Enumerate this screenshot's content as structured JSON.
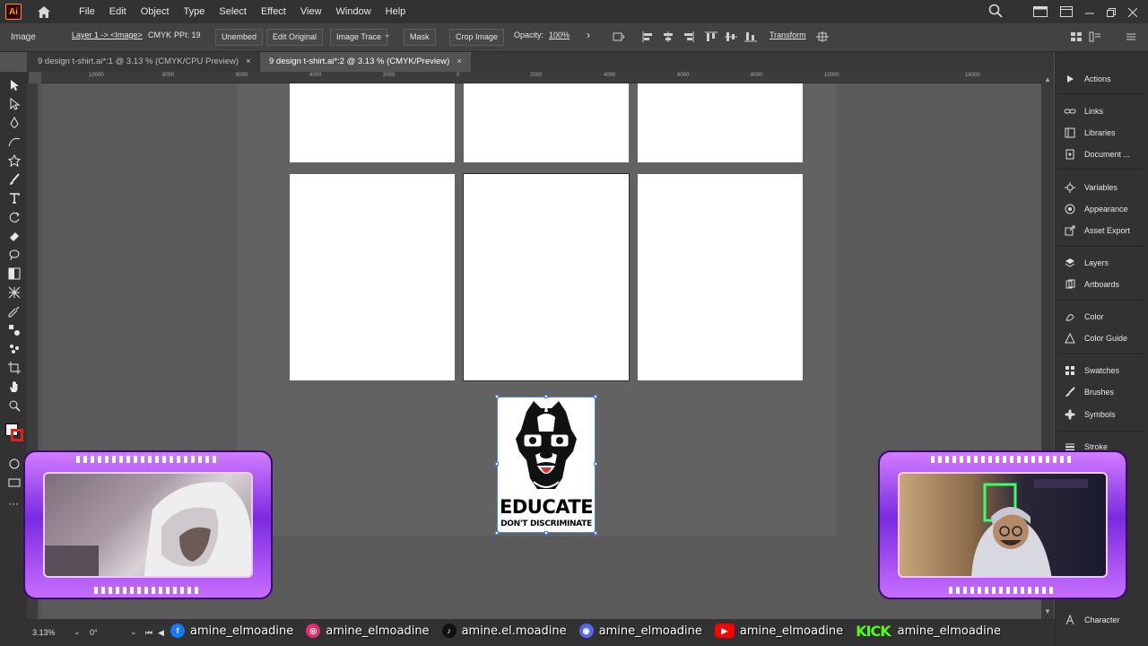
{
  "app": {
    "logo": "Ai"
  },
  "menu": [
    "File",
    "Edit",
    "Object",
    "Type",
    "Select",
    "Effect",
    "View",
    "Window",
    "Help"
  ],
  "control": {
    "image": "Image",
    "layer": "Layer 1 -> <Image>",
    "mode": "CMYK",
    "ppi": "PPI: 19",
    "unembed": "Unembed",
    "edit_original": "Edit Original",
    "image_trace": "Image Trace",
    "mask": "Mask",
    "crop": "Crop Image",
    "opacity_label": "Opacity:",
    "opacity_value": "100%",
    "transform": "Transform"
  },
  "tabs": [
    {
      "label": "9 design t-shirt.ai*:1 @ 3.13 % (CMYK/CPU Preview)",
      "close": "×"
    },
    {
      "label": "9 design t-shirt.ai*:2 @ 3.13 % (CMYK/Preview)",
      "close": "×"
    }
  ],
  "ruler": [
    "10000",
    "8000",
    "6000",
    "4000",
    "2000",
    "0",
    "2000",
    "4000",
    "6000",
    "8000",
    "10000",
    "14000"
  ],
  "artwork": {
    "title": "EDUCATE",
    "subtitle": "DON'T DISCRIMINATE"
  },
  "panels": [
    "Actions",
    "Links",
    "Libraries",
    "Document ...",
    "Variables",
    "Appearance",
    "Asset Export",
    "Layers",
    "Artboards",
    "Color",
    "Color Guide",
    "Swatches",
    "Brushes",
    "Symbols",
    "Stroke",
    "Character"
  ],
  "status": {
    "zoom": "3.13%",
    "rotation": "0°"
  },
  "social": [
    {
      "icon": "facebook-icon",
      "letter": "f",
      "color": "#1877f2",
      "handle": "amine_elmoadine"
    },
    {
      "icon": "instagram-icon",
      "letter": "◎",
      "color": "#e1306c",
      "handle": "amine_elmoadine"
    },
    {
      "icon": "tiktok-icon",
      "letter": "♪",
      "color": "#111111",
      "handle": "amine.el.moadine"
    },
    {
      "icon": "discord-icon",
      "letter": "◉",
      "color": "#5865f2",
      "handle": "amine_elmoadine"
    },
    {
      "icon": "youtube-icon",
      "letter": "▶",
      "color": "#ff0000",
      "handle": "amine_elmoadine"
    },
    {
      "icon": "kick-icon",
      "letter": "KICK",
      "color": "#53fc18",
      "handle": "amine_elmoadine"
    }
  ]
}
